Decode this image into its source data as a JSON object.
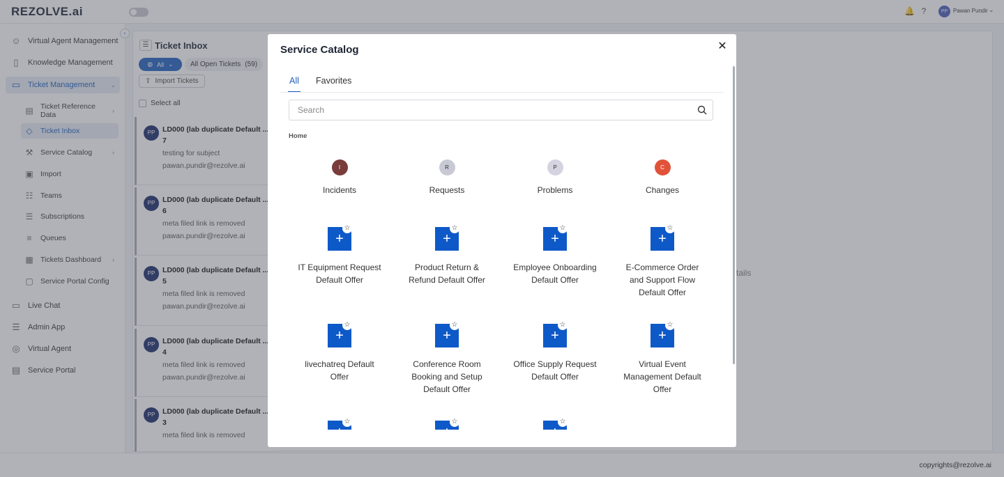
{
  "app": {
    "logo": "REZOLVE.ai",
    "user_initials": "PP",
    "user_name": "Pawan Pundir"
  },
  "sidebar": {
    "items": [
      {
        "label": "Virtual Agent Management",
        "icon": "users-icon"
      },
      {
        "label": "Knowledge Management",
        "icon": "book-icon"
      },
      {
        "label": "Ticket Management",
        "icon": "ticket-icon"
      },
      {
        "label": "Live Chat",
        "icon": "chat-icon"
      },
      {
        "label": "Admin App",
        "icon": "sliders-icon"
      },
      {
        "label": "Virtual Agent",
        "icon": "bot-icon"
      },
      {
        "label": "Service Portal",
        "icon": "portal-icon"
      }
    ],
    "sub_items": [
      {
        "label": "Ticket Reference Data"
      },
      {
        "label": "Ticket Inbox"
      },
      {
        "label": "Service Catalog"
      },
      {
        "label": "Import"
      },
      {
        "label": "Teams"
      },
      {
        "label": "Subscriptions"
      },
      {
        "label": "Queues"
      },
      {
        "label": "Tickets Dashboard"
      },
      {
        "label": "Service Portal Config"
      }
    ]
  },
  "inbox": {
    "title": "Ticket Inbox",
    "filter_all": "All",
    "open_tickets_label": "All Open Tickets",
    "open_tickets_count": "(59)",
    "import_label": "Import Tickets",
    "select_all": "Select all",
    "tickets": [
      {
        "initials": "PP",
        "title": "LD000 (lab duplicate Default ...",
        "number": "7",
        "subject": "testing for subject",
        "email": "pawan.pundir@rezolve.ai"
      },
      {
        "initials": "PP",
        "title": "LD000 (lab duplicate Default ...",
        "number": "6",
        "subject": "meta filed link is removed",
        "email": "pawan.pundir@rezolve.ai"
      },
      {
        "initials": "PP",
        "title": "LD000 (lab duplicate Default ...",
        "number": "5",
        "subject": "meta filed link is removed",
        "email": "pawan.pundir@rezolve.ai"
      },
      {
        "initials": "PP",
        "title": "LD000 (lab duplicate Default ...",
        "number": "4",
        "subject": "meta filed link is removed",
        "email": "pawan.pundir@rezolve.ai"
      },
      {
        "initials": "PP",
        "title": "LD000 (lab duplicate Default ...",
        "number": "3",
        "subject": "meta filed link is removed",
        "email": ""
      }
    ],
    "details_fragment": "tails"
  },
  "footer": {
    "text": "copyrights@rezolve.ai"
  },
  "modal": {
    "title": "Service Catalog",
    "tabs": [
      "All",
      "Favorites"
    ],
    "search_placeholder": "Search",
    "breadcrumb": "Home",
    "categories": [
      {
        "letter": "I",
        "label": "Incidents",
        "color": "#7a3b3b"
      },
      {
        "letter": "R",
        "label": "Requests",
        "color": "#c9c9d6"
      },
      {
        "letter": "P",
        "label": "Problems",
        "color": "#d5d3e0"
      },
      {
        "letter": "C",
        "label": "Changes",
        "color": "#e0533a"
      }
    ],
    "offers": [
      {
        "label": "IT Equipment Request Default Offer"
      },
      {
        "label": "Product Return & Refund Default Offer"
      },
      {
        "label": "Employee Onboarding Default Offer"
      },
      {
        "label": "E-Commerce Order and Support Flow Default Offer"
      },
      {
        "label": "livechatreq Default Offer"
      },
      {
        "label": "Conference Room Booking and Setup Default Offer"
      },
      {
        "label": "Office Supply Request Default Offer"
      },
      {
        "label": "Virtual Event Management Default Offer"
      },
      {
        "label": ""
      },
      {
        "label": ""
      },
      {
        "label": ""
      }
    ],
    "colors": {
      "accent": "#1f5fbf",
      "tile": "#0e59c8"
    }
  }
}
